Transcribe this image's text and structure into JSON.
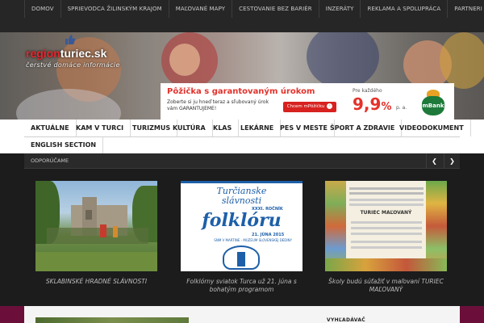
{
  "top_nav": {
    "items": [
      "DOMOV",
      "SPRIEVODCA ŽILINSKÝM KRAJOM",
      "MAĽOVANÉ MAPY",
      "CESTOVANIE BEZ BARIÉR",
      "INZERÁTY",
      "REKLAMA A SPOLUPRÁCA",
      "PARTNERI"
    ]
  },
  "logo": {
    "brand_region": "region",
    "brand_turiec": "turiec",
    "brand_dot": ".",
    "brand_sk": "sk",
    "tagline": "čerstvé domáce informácie",
    "thumb_icon": "thumbs-up-icon"
  },
  "ad": {
    "title": "Pôžička s garantovaným úrokom",
    "text": "Zoberte si ju hneď teraz a sľubovaný úrok vám GARANTUJEME!",
    "button": "Chcem mPôžičku",
    "button_icon": "arrow-right-icon",
    "pre_label": "Pre každého",
    "rate": "9,9",
    "percent": "%",
    "pa": "p. a.",
    "bank": "mBank"
  },
  "main_nav": {
    "row1": [
      "AKTUÁLNE",
      "KAM V TURCI",
      "TURIZMUS",
      "KULTÚRA",
      "KLAS",
      "LEKÁRNE",
      "PES V MESTE",
      "ŠPORT A ZDRAVIE",
      "VIDEODOKUMENT"
    ],
    "row2": [
      "ENGLISH SECTION"
    ]
  },
  "recommend": {
    "label": "ODPORÚČAME",
    "prev_icon": "chevron-left-icon",
    "next_icon": "chevron-right-icon"
  },
  "cards": [
    {
      "caption": "SKLABINSKÉ HRADNÉ SLÁVNOSTI"
    },
    {
      "caption": "Folklórny sviatok Turca už 21. júna s bohatým programom"
    },
    {
      "caption": "Školy budú súťažiť v maľovaní TURIEC MAĽOVANÝ"
    }
  ],
  "poster": {
    "line1": "Turčianske",
    "line2": "slávnosti",
    "line3": "folklóru",
    "edition": "XXXI. ROČNÍK",
    "date": "21. JÚNA 2015",
    "venue": "SNM V MARTINE - MÚZEUM SLOVENSKEJ DEDINY"
  },
  "flyer": {
    "title": "TURIEC MAĽOVANÝ"
  },
  "bottom": {
    "label": "VYHĽADÁVAČ"
  },
  "colors": {
    "topnav_bg": "#262626",
    "accent_red": "#e4322b",
    "poster_blue": "#1d5fa8",
    "bottom_accent": "#6b0f3a"
  }
}
